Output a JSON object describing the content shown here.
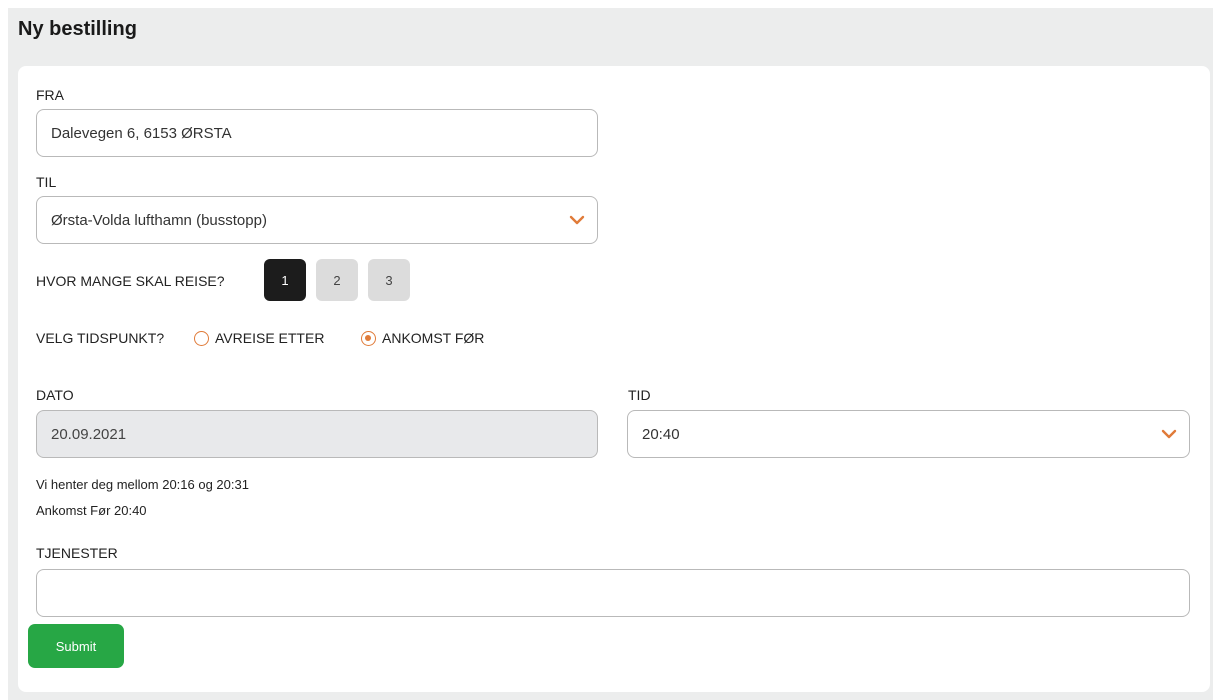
{
  "page": {
    "title": "Ny bestilling"
  },
  "form": {
    "from": {
      "label": "FRA",
      "value": "Dalevegen 6, 6153 ØRSTA"
    },
    "to": {
      "label": "TIL",
      "selected": "Ørsta-Volda lufthamn (busstopp)",
      "icon": "chevron-down-icon"
    },
    "passengers": {
      "label": "HVOR MANGE SKAL REISE?",
      "options": [
        "1",
        "2",
        "3"
      ],
      "selected": "1"
    },
    "time_choice": {
      "label": "VELG TIDSPUNKT?",
      "options": [
        {
          "label": "AVREISE ETTER",
          "checked": false
        },
        {
          "label": "ANKOMST FØR",
          "checked": true
        }
      ]
    },
    "date": {
      "label": "DATO",
      "value": "20.09.2021"
    },
    "time": {
      "label": "TID",
      "selected": "20:40",
      "icon": "chevron-down-icon"
    },
    "info": {
      "pickup": "Vi henter deg mellom 20:16 og 20:31",
      "arrival": "Ankomst Før 20:40"
    },
    "services": {
      "label": "TJENESTER",
      "value": ""
    },
    "submit_label": "Submit"
  },
  "colors": {
    "accent": "#e07b39",
    "submit": "#27a745",
    "selected_button": "#1c1c1c",
    "background": "#eceded"
  }
}
